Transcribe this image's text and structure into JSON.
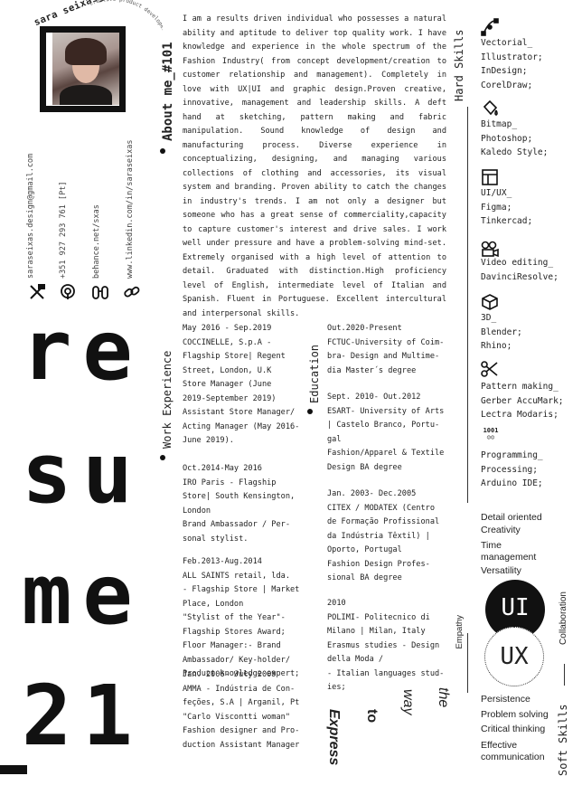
{
  "header": {
    "name": "sara seixas_",
    "arc_text": "creative product developer designer",
    "about_heading": "About me_#101",
    "about_text": "I am a results driven individual who possesses a natural ability and aptitude to deliver top quality work. I have knowledge and experience in the whole spectrum of the Fashion Industry( from concept development/creation to customer relationship and management). Completely in love with UX|UI and graphic design.Proven creative, innovative, management and leadership skills. A deft hand at sketching, pattern making and fabric manipulation. Sound knowledge of design and manufacturing process. Diverse experience in conceptualizing, designing, and managing various collections of clothing and accessories, its visual system and branding. Proven ability to catch the changes in industry's trends. I am not only a designer but someone who has a great sense of commerciality,capacity to capture customer's interest and drive sales. I work well under pressure and have a problem-solving mind-set. Extremely organised with a high level of attention to detail. Graduated with distinction.High proficiency level of English, intermediate level of Italian and Spanish. Fluent in Portuguese. Excellent intercultural and interpersonal skills."
  },
  "contact": {
    "email": "saraseixas.design@gmail.com",
    "phone": "+351 927 293 761 [Pt]",
    "behance": "behance.net/sxas",
    "linkedin": "www.linkedin.com/in/saraseixas",
    "icons": [
      "tools-icon",
      "podcast-icon",
      "binoculars-icon",
      "link-icon"
    ]
  },
  "resume_word": [
    "re",
    "su",
    "me",
    "21"
  ],
  "work": {
    "heading": "Work Experience",
    "entries": [
      "May 2016 - Sep.2019\nCOCCINELLE, S.p.A -\nFlagship Store| Regent\nStreet, London, U.K\nStore Manager (June\n2019-September 2019)\nAssistant Store Manager/\nActing Manager (May 2016-\nJune 2019).",
      "Oct.2014-May 2016\nIRO Paris - Flagship\nStore| South Kensington,\nLondon\nBrand Ambassador / Per-\nsonal stylist.",
      "Feb.2013-Aug.2014\nALL SAINTS retail, lda.\n- Flagship Store | Market\nPlace, London\n\"Stylist of the Year\"-\nFlagship Stores Award;\nFloor Manager:- Brand\nAmbassador/ Key-holder/\nProduct knowledge expert;",
      "Jan. 2006- July 2009\nAMMA - Indústria de Con-\nfeções, S.A | Arganil, Pt\n\"Carlo Viscontti woman\"\nFashion designer and Pro-\nduction Assistant Manager"
    ]
  },
  "education": {
    "heading": "Education",
    "entries": [
      "Out.2020-Present\nFCTUC-University of Coim-\nbra- Design and Multime-\ndia Master´s degree",
      "Sept. 2010- Out.2012\nESART- University of Arts\n| Castelo Branco, Portu-\ngal\nFashion/Apparel & Textile\nDesign BA degree",
      "Jan. 2003- Dec.2005\nCITEX / MODATEX (Centro\nde Formação Profissional\nda Indústria Têxtil) |\nOporto, Portugal\nFashion Design Profes-\nsional BA degree",
      "2010\nPOLIMI- Politecnico di\nMilano | Milan, Italy\nErasmus studies - Design\ndella Moda /\n- Italian languages stud-\nies;"
    ]
  },
  "tagline": [
    "Express",
    "to",
    "way",
    "the"
  ],
  "hard_skills": {
    "heading": "Hard Skills",
    "items": [
      {
        "icon": "vector-icon",
        "text": "Vectorial_\nIllustrator;\nInDesign;\nCorelDraw;"
      },
      {
        "icon": "paint-bucket-icon",
        "text": "Bitmap_\nPhotoshop;\nKaledo Style;"
      },
      {
        "icon": "layout-icon",
        "text": "UI/UX_\nFigma;\nTinkercad;"
      },
      {
        "icon": "film-camera-icon",
        "text": "Video editing_\nDavinciResolve;"
      },
      {
        "icon": "cube-icon",
        "text": "3D_\nBlender;\nRhino;"
      },
      {
        "icon": "scissors-icon",
        "text": "Pattern making_\nGerber AccuMark;\nLectra Modaris;"
      },
      {
        "icon": "binary-person-icon",
        "text": "Programming_\nProcessing;\nArduino IDE;"
      }
    ]
  },
  "soft_skills": {
    "heading": "Soft Skills",
    "top": [
      "Detail oriented",
      "Creativity",
      "Time\nmanagement",
      "Versatility"
    ],
    "empathy": "Empathy",
    "collaboration": "Collaboration",
    "ui": "UI",
    "ux": "UX",
    "bottom": [
      "Persistence",
      "Problem solving",
      "Critical thinking",
      "Effective\ncommunication"
    ]
  }
}
